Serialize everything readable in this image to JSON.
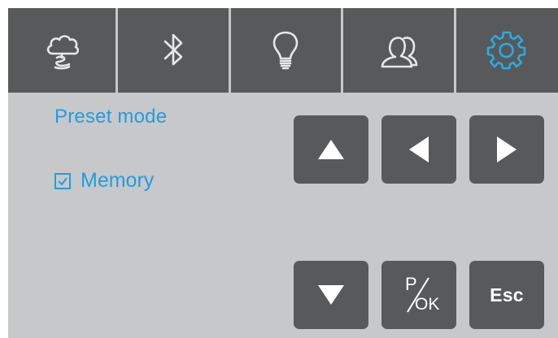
{
  "tabs": [
    {
      "id": "mist",
      "icon": "cloud-mist-icon",
      "active": false
    },
    {
      "id": "bluetooth",
      "icon": "bluetooth-icon",
      "active": false
    },
    {
      "id": "light",
      "icon": "lightbulb-icon",
      "active": false
    },
    {
      "id": "users",
      "icon": "users-icon",
      "active": false
    },
    {
      "id": "settings",
      "icon": "gear-icon",
      "active": true
    }
  ],
  "colors": {
    "background": "#c7c8ca",
    "tile": "#58595b",
    "icon": "#e6e7e8",
    "accent": "#29abe2",
    "text_accent": "#1f9ee0"
  },
  "settings": {
    "title": "Preset mode",
    "memory_label": "Memory",
    "memory_checked": true
  },
  "keys": {
    "up_icon": "arrow-up-icon",
    "left_icon": "arrow-left-icon",
    "right_icon": "arrow-right-icon",
    "down_icon": "arrow-down-icon",
    "pok_top": "P",
    "pok_bottom": "OK",
    "esc_label": "Esc"
  }
}
